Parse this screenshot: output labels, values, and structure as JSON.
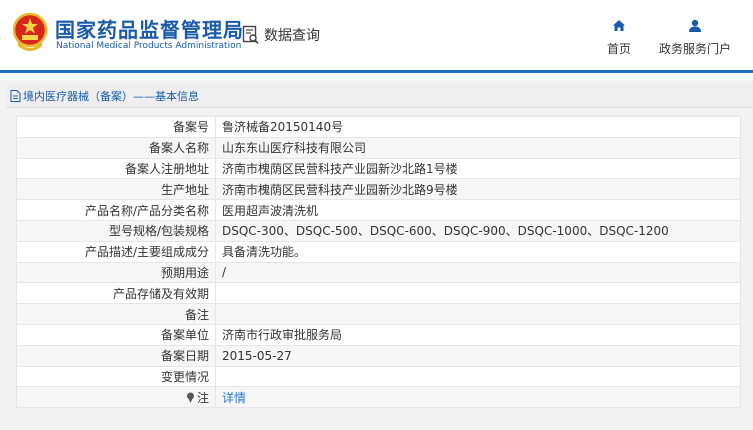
{
  "header": {
    "site_name_cn": "国家药品监督管理局",
    "site_name_en": "National Medical Products Administration",
    "query_label": "数据查询",
    "nav": [
      {
        "label": "首页",
        "icon": "home-icon"
      },
      {
        "label": "政务服务门户",
        "icon": "user-icon"
      }
    ]
  },
  "panel": {
    "title": "境内医疗器械（备案）——基本信息"
  },
  "rows": [
    {
      "key": "备案号",
      "value": "鲁济械备20150140号"
    },
    {
      "key": "备案人名称",
      "value": "山东东山医疗科技有限公司"
    },
    {
      "key": "备案人注册地址",
      "value": "济南市槐荫区民营科技产业园新沙北路1号楼"
    },
    {
      "key": "生产地址",
      "value": "济南市槐荫区民营科技产业园新沙北路9号楼"
    },
    {
      "key": "产品名称/产品分类名称",
      "value": "医用超声波清洗机"
    },
    {
      "key": "型号规格/包装规格",
      "value": "DSQC-300、DSQC-500、DSQC-600、DSQC-900、DSQC-1000、DSQC-1200"
    },
    {
      "key": "产品描述/主要组成成分",
      "value": "具备清洗功能。"
    },
    {
      "key": "预期用途",
      "value": "/"
    },
    {
      "key": "产品存储及有效期",
      "value": ""
    },
    {
      "key": "备注",
      "value": ""
    },
    {
      "key": "备案单位",
      "value": "济南市行政审批服务局"
    },
    {
      "key": "备案日期",
      "value": "2015-05-27"
    },
    {
      "key": "变更情况",
      "value": ""
    }
  ],
  "note_row": {
    "key": "注",
    "link": "详情"
  },
  "colors": {
    "brand_blue": "#1a5aa8",
    "link_blue": "#2a78c8",
    "logo_red": "#d8261c",
    "logo_gold": "#e8b82a"
  }
}
